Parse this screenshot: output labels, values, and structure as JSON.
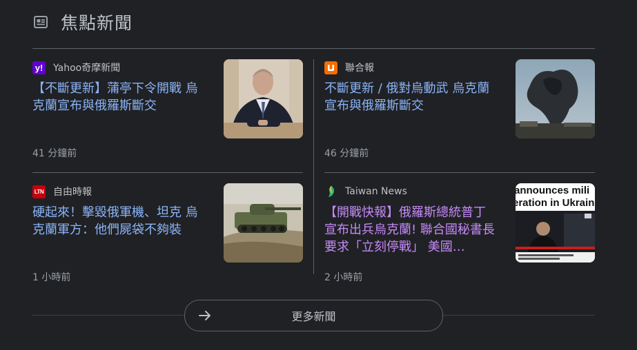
{
  "section": {
    "title": "焦點新聞",
    "icon": "news-icon"
  },
  "articles": [
    {
      "source": "Yahoo奇摩新聞",
      "logo_text": "y!",
      "headline": "【不斷更新】蒲亭下令開戰 烏克蘭宣布與俄羅斯斷交",
      "time": "41 分鐘前"
    },
    {
      "source": "聯合報",
      "logo_text": "u",
      "headline": "不斷更新 / 俄對烏動武 烏克蘭宣布與俄羅斯斷交",
      "time": "46 分鐘前"
    },
    {
      "source": "自由時報",
      "logo_text": "LTN",
      "headline": "硬起來！擊毀俄軍機、坦克 烏克蘭軍方：他們屍袋不夠裝",
      "time": "1 小時前"
    },
    {
      "source": "Taiwan News",
      "logo_text": "",
      "headline": "【開戰快報】俄羅斯總統普丁宣布出兵烏克蘭! 聯合國秘書長要求「立刻停戰」 美國…",
      "time": "2 小時前",
      "thumb_caption_1": "announces mili",
      "thumb_caption_2": "eration in Ukrain"
    }
  ],
  "more_button": {
    "label": "更多新聞"
  }
}
